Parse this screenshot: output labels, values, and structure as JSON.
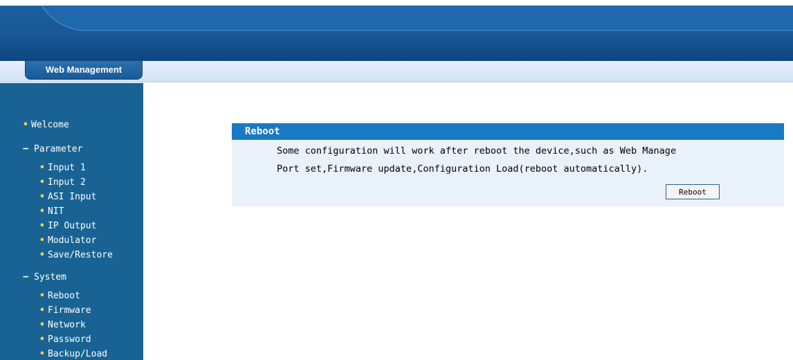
{
  "header": {
    "tab_label": "Web Management"
  },
  "sidebar": {
    "welcome": "Welcome",
    "parameter_section": "Parameter",
    "parameter_items": [
      "Input 1",
      "Input 2",
      "ASI Input",
      "NIT",
      "IP Output",
      "Modulator",
      "Save/Restore"
    ],
    "system_section": "System",
    "system_items": [
      "Reboot",
      "Firmware",
      "Network",
      "Password",
      "Backup/Load"
    ]
  },
  "panel": {
    "title": "Reboot",
    "description_line1": "Some configuration will work after reboot the device,such as Web Manage",
    "description_line2": "Port set,Firmware update,Configuration Load(reboot automatically).",
    "button_label": "Reboot"
  },
  "colors": {
    "banner": "#1a5896",
    "sidebar": "#186394",
    "panel_title": "#1a79c3",
    "panel_bg": "#e9f1fa",
    "bullet": "#f2d24a"
  }
}
